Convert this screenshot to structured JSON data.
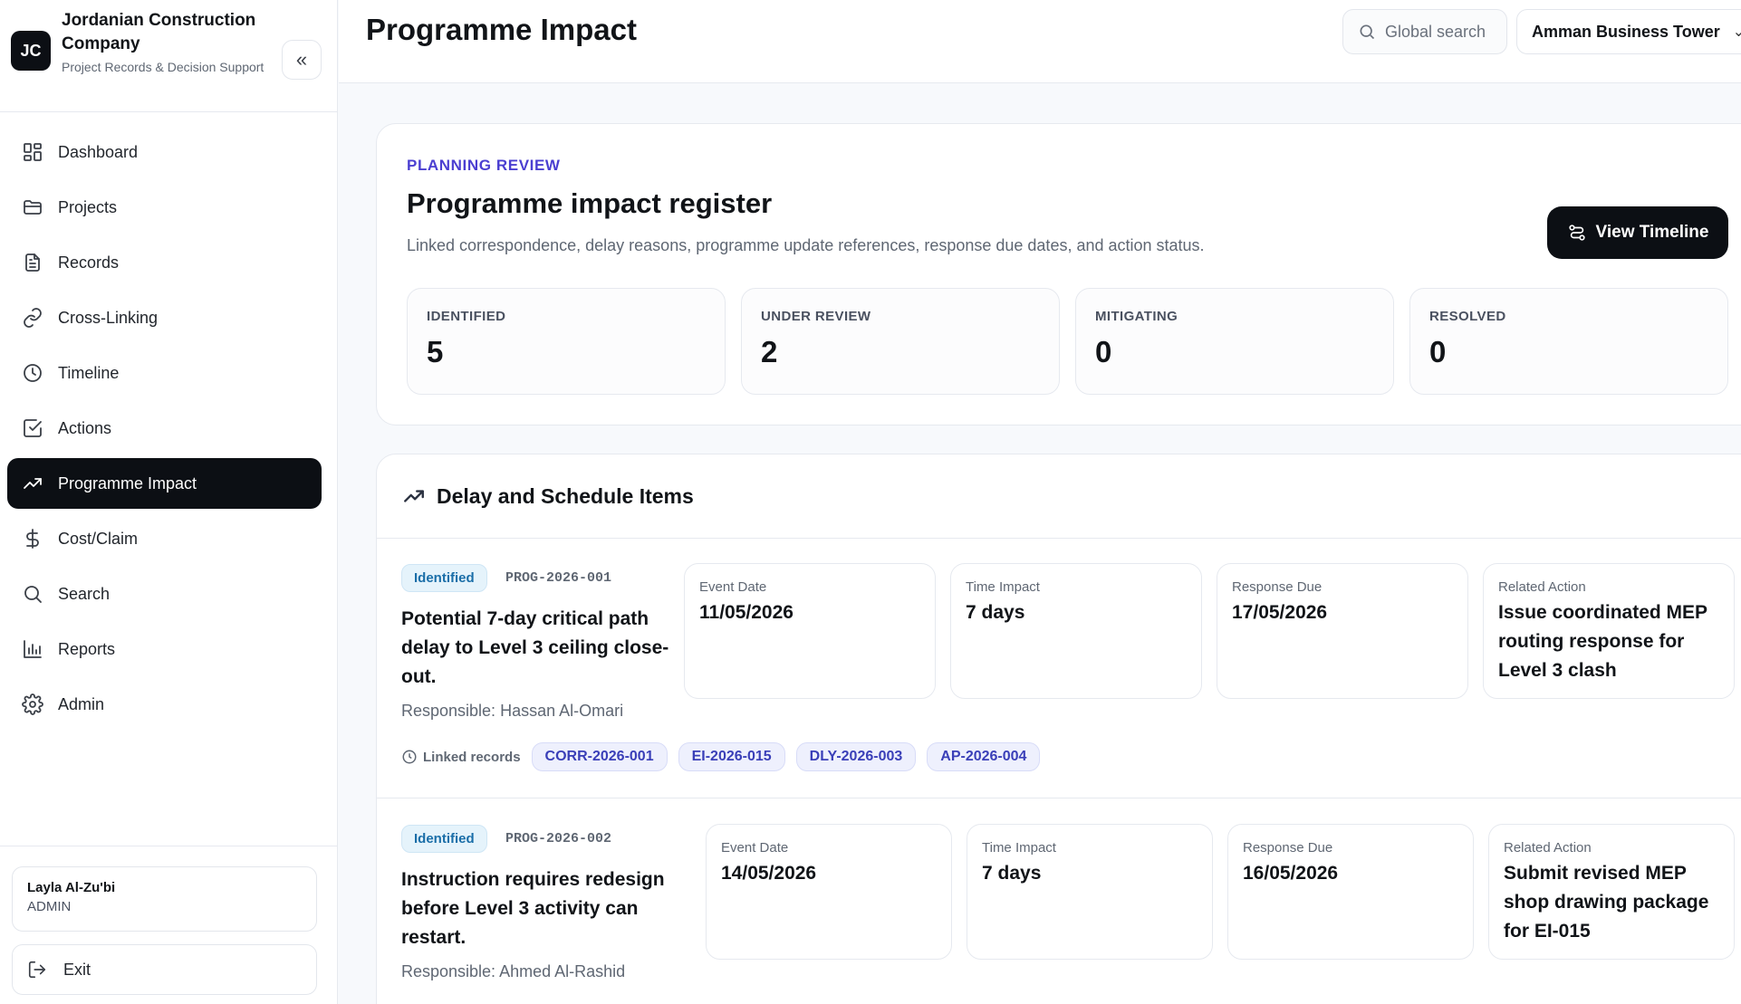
{
  "sidebar": {
    "logo_initials": "JC",
    "company_name": "Jordanian Construction Company",
    "tagline": "Project Records & Decision Support",
    "collapse_glyph": "«",
    "items": [
      {
        "label": "Dashboard",
        "icon": "dashboard-icon"
      },
      {
        "label": "Projects",
        "icon": "folder-icon"
      },
      {
        "label": "Records",
        "icon": "document-icon"
      },
      {
        "label": "Cross-Linking",
        "icon": "link-icon"
      },
      {
        "label": "Timeline",
        "icon": "clock-icon"
      },
      {
        "label": "Actions",
        "icon": "checkbox-icon"
      },
      {
        "label": "Programme Impact",
        "icon": "trending-up-icon",
        "active": true
      },
      {
        "label": "Cost/Claim",
        "icon": "dollar-icon"
      },
      {
        "label": "Search",
        "icon": "search-icon"
      },
      {
        "label": "Reports",
        "icon": "bar-chart-icon"
      },
      {
        "label": "Admin",
        "icon": "gear-icon"
      }
    ],
    "user": {
      "name": "Layla Al-Zu'bi",
      "role": "ADMIN"
    },
    "exit_label": "Exit"
  },
  "header": {
    "title": "Programme Impact",
    "search_placeholder": "Global search",
    "project": "Amman Business Tower",
    "project_chevron": "⌄"
  },
  "review": {
    "eyebrow": "PLANNING REVIEW",
    "title": "Programme impact register",
    "description": "Linked correspondence, delay reasons, programme update references, response due dates, and action status.",
    "timeline_button": "View Timeline",
    "stats": [
      {
        "label": "IDENTIFIED",
        "value": "5"
      },
      {
        "label": "UNDER REVIEW",
        "value": "2"
      },
      {
        "label": "MITIGATING",
        "value": "0"
      },
      {
        "label": "RESOLVED",
        "value": "0"
      }
    ]
  },
  "items_section": {
    "title": "Delay and Schedule Items",
    "linked_label": "Linked records",
    "items": [
      {
        "status": "Identified",
        "id": "PROG-2026-001",
        "title": "Potential 7-day critical path delay to Level 3 ceiling close-out.",
        "responsible": "Responsible: Hassan Al-Omari",
        "fields": [
          {
            "label": "Event Date",
            "value": "11/05/2026"
          },
          {
            "label": "Time Impact",
            "value": "7 days"
          },
          {
            "label": "Response Due",
            "value": "17/05/2026"
          },
          {
            "label": "Related Action",
            "value": "Issue coordinated MEP routing response for Level 3 clash"
          }
        ],
        "linked": [
          "CORR-2026-001",
          "EI-2026-015",
          "DLY-2026-003",
          "AP-2026-004"
        ]
      },
      {
        "status": "Identified",
        "id": "PROG-2026-002",
        "title": "Instruction requires redesign before Level 3 activity can restart.",
        "responsible": "Responsible: Ahmed Al-Rashid",
        "fields": [
          {
            "label": "Event Date",
            "value": "14/05/2026"
          },
          {
            "label": "Time Impact",
            "value": "7 days"
          },
          {
            "label": "Response Due",
            "value": "16/05/2026"
          },
          {
            "label": "Related Action",
            "value": "Submit revised MEP shop drawing package for EI-015"
          }
        ]
      }
    ]
  }
}
